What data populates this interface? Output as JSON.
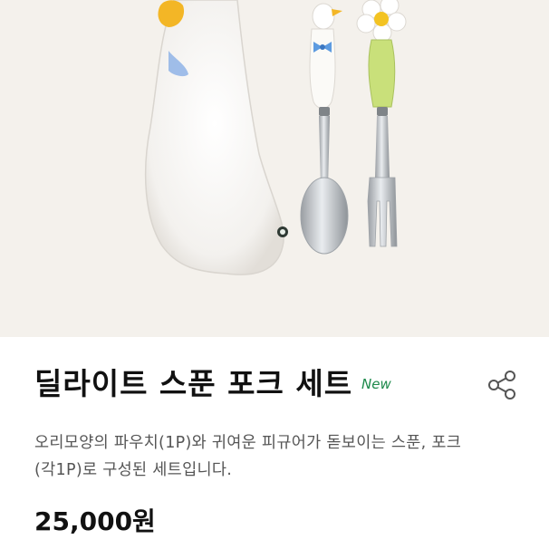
{
  "product": {
    "title": "딜라이트 스푼 포크 세트",
    "badge": "New",
    "description_lines": [
      "오리모양의 파우치(1P)와 귀여운 피규어가 돋보이는 스푼, 포크",
      "(각1P)로 구성된 세트입니다."
    ],
    "price": "25,000원"
  },
  "icons": {
    "share": "share-icon"
  },
  "colors": {
    "badge": "#1e8a4c",
    "hero_background": "#f4f1ec"
  }
}
